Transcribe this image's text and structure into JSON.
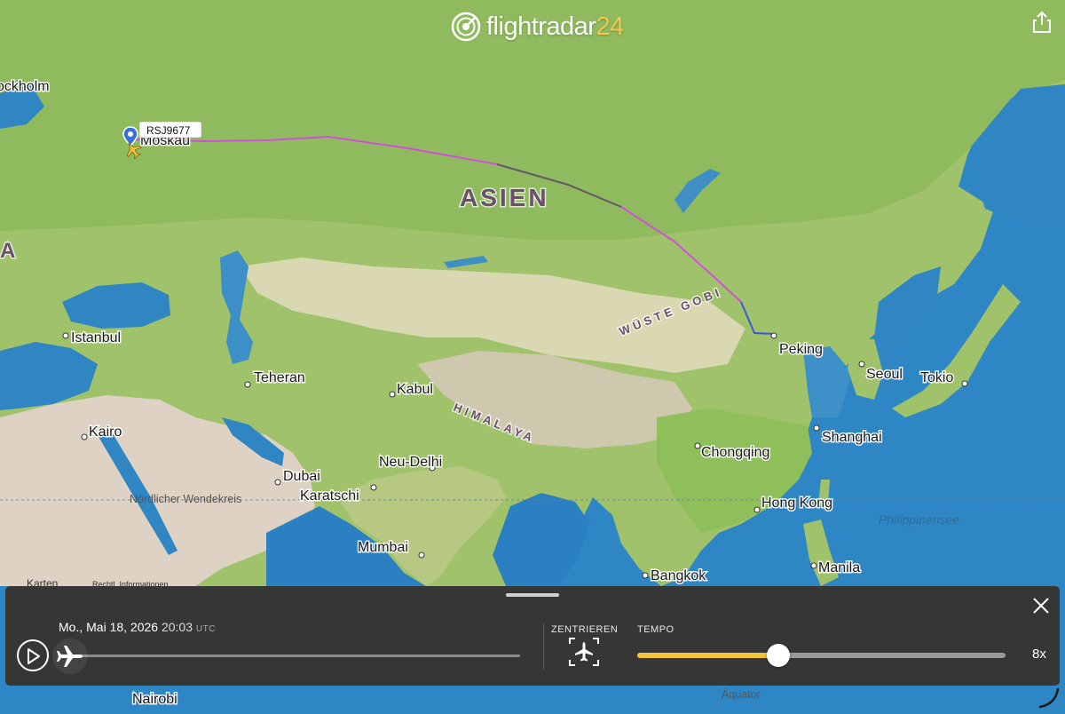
{
  "app": {
    "brand_main": "flightradar",
    "brand_num": "24"
  },
  "map": {
    "flight_label": "RSJ9677",
    "cities": [
      {
        "id": "stockholm",
        "name": "ockholm"
      },
      {
        "id": "moskau",
        "name": "Moskau"
      },
      {
        "id": "istanbul",
        "name": "Istanbul"
      },
      {
        "id": "teheran",
        "name": "Teheran"
      },
      {
        "id": "kabul",
        "name": "Kabul"
      },
      {
        "id": "kairo",
        "name": "Kairo"
      },
      {
        "id": "dubai",
        "name": "Dubai"
      },
      {
        "id": "karatschi",
        "name": "Karatschi"
      },
      {
        "id": "neu-delhi",
        "name": "Neu-Delhi"
      },
      {
        "id": "mumbai",
        "name": "Mumbai"
      },
      {
        "id": "peking",
        "name": "Peking"
      },
      {
        "id": "seoul",
        "name": "Seoul"
      },
      {
        "id": "tokio",
        "name": "Tokio"
      },
      {
        "id": "shanghai",
        "name": "Shanghai"
      },
      {
        "id": "chongqing",
        "name": "Chongqing"
      },
      {
        "id": "hongkong",
        "name": "Hong Kong"
      },
      {
        "id": "manila",
        "name": "Manila"
      },
      {
        "id": "bangkok",
        "name": "Bangkok"
      },
      {
        "id": "nairobi",
        "name": "Nairobi"
      }
    ],
    "regions": {
      "asien": "ASIEN",
      "gobi": "WÜSTE GOBI",
      "himalaya": "HIMALAYA",
      "tropic": "Nördlicher Wendekreis",
      "sea": "Philippinensee",
      "equator": "Äquator",
      "edge_letter": "A"
    },
    "attribution": {
      "provider": "Karten",
      "legal": "Rechtl. Informationen"
    }
  },
  "playback": {
    "date": "Mo., Mai 18, 2026",
    "time": "20:03",
    "tz": "UTC",
    "progress": 0,
    "center_label": "ZENTRIEREN",
    "tempo_label": "TEMPO",
    "tempo_fraction": 0.383,
    "speed": "8x"
  },
  "colors": {
    "route_magenta": "#d24fd8",
    "route_dark": "#5f5f5f",
    "route_blue": "#3f56d8",
    "accent_yellow": "#f3c33b",
    "panel_bg": "#363636"
  }
}
